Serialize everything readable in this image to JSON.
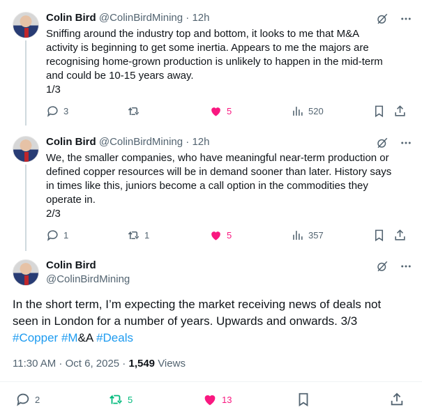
{
  "tweets": [
    {
      "name": "Colin Bird",
      "handle": "@ColinBirdMining",
      "time": "12h",
      "text_lines": [
        "Sniffing around the industry top and bottom, it looks to me that M&A",
        "activity is beginning to get some inertia. Appears to me the majors are",
        "recognising home-grown production is unlikely to happen in the mid-term",
        "and could be 10-15 years away.",
        "1/3"
      ],
      "replies": "3",
      "retweets": "",
      "likes": "5",
      "views": "520"
    },
    {
      "name": "Colin Bird",
      "handle": "@ColinBirdMining",
      "time": "12h",
      "text_lines": [
        "We, the smaller companies, who have meaningful near-term production or",
        "defined copper resources will be in demand sooner than later. History says",
        "in times like this, juniors become a call option in the commodities they",
        "operate in.",
        "2/3"
      ],
      "replies": "1",
      "retweets": "1",
      "likes": "5",
      "views": "357"
    }
  ],
  "main": {
    "name": "Colin Bird",
    "handle": "@ColinBirdMining",
    "text_line1": "In the short term, I’m expecting the market receiving news of deals not",
    "text_line2": "seen in London for a number of years. Upwards and onwards. 3/3",
    "hashtag1": "#Copper",
    "hashtag2": "#M",
    "hashtag2_rest": "&A",
    "hashtag3": "#Deals",
    "timestamp": "11:30 AM · Oct 6, 2025 · ",
    "views_count": "1,549",
    "views_label": " Views",
    "replies": "2",
    "retweets": "5",
    "likes": "13"
  },
  "colors": {
    "accent": "#1d9bf0",
    "like": "#f91880",
    "retweet": "#00ba7c",
    "muted": "#536471"
  },
  "icons": [
    "grok-icon",
    "more-icon",
    "reply-icon",
    "retweet-icon",
    "like-icon",
    "views-icon",
    "bookmark-icon",
    "share-icon"
  ]
}
